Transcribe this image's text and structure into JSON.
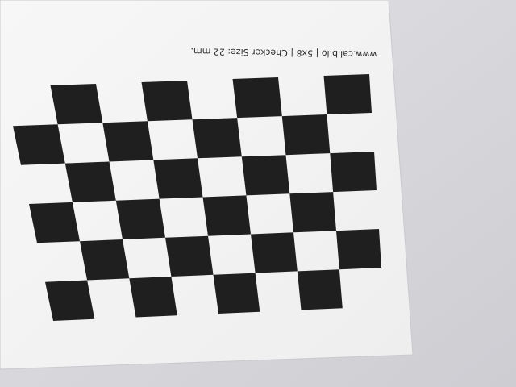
{
  "photo": {
    "subject": "checkerboard-calibration-target",
    "caption": "www.calib.io | 5x8 | Checker Size: 22 mm.",
    "colors": {
      "background": "#d9d9dd",
      "paper": "#f4f4f4",
      "square": "#1f1f1f",
      "paper_edge": "#cfcfd3"
    }
  }
}
